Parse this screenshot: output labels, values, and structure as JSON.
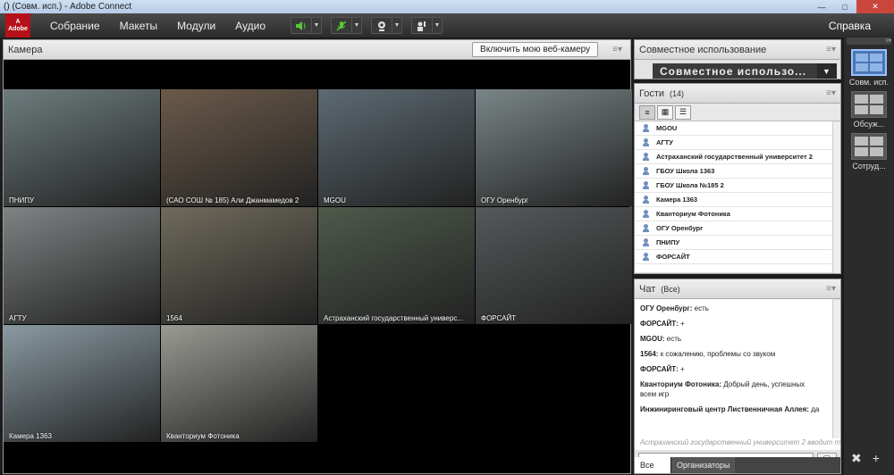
{
  "window": {
    "title": "() (Совм. исп.) - Adobe Connect"
  },
  "menubar": {
    "logo_text": "Adobe",
    "items": [
      "Собрание",
      "Макеты",
      "Модули",
      "Аудио"
    ],
    "help": "Справка"
  },
  "camera_pod": {
    "title": "Камера",
    "webcam_button": "Включить мою веб-камеру",
    "tiles": [
      {
        "label": "ПНИПУ",
        "bg": "#6e7c7d"
      },
      {
        "label": "(САО СОШ № 185) Али Джанмамедов 2",
        "bg": "#6b5a4a"
      },
      {
        "label": "MGOU",
        "bg": "#5d6a72"
      },
      {
        "label": "ОГУ Оренбург",
        "bg": "#7a8587"
      },
      {
        "label": "АГТУ",
        "bg": "#7f8384"
      },
      {
        "label": "1564",
        "bg": "#6f6a5c"
      },
      {
        "label": "Астраханский государственный универс...",
        "bg": "#4e5a4c"
      },
      {
        "label": "ФОРСАЙТ",
        "bg": "#55595a"
      },
      {
        "label": "Камера 1363",
        "bg": "#8a9aa2"
      },
      {
        "label": "Кванториум Фотоника",
        "bg": "#9a9a94"
      }
    ]
  },
  "share_pod": {
    "title": "Совместное использование",
    "selector": "Совместное использо..."
  },
  "guests_pod": {
    "title": "Гости",
    "count": "(14)",
    "guests": [
      "MGOU",
      "АГТУ",
      "Астраханский государственный университет 2",
      "ГБОУ Школа 1363",
      "ГБОУ Школа №185 2",
      "Камера 1363",
      "Кванториум Фотоника",
      "ОГУ Оренбург",
      "ПНИПУ",
      "ФОРСАЙТ"
    ]
  },
  "chat_pod": {
    "title": "Чат",
    "scope": "(Все)",
    "messages": [
      {
        "sender": "ОГУ Оренбург:",
        "text": " есть"
      },
      {
        "sender": "ФОРСАЙТ:",
        "text": " +"
      },
      {
        "sender": "MGOU:",
        "text": " есть"
      },
      {
        "sender": "1564:",
        "text": " к сожалению, проблемы со звуком"
      },
      {
        "sender": "ФОРСАЙТ:",
        "text": " +"
      },
      {
        "sender": "Кванториум Фотоника:",
        "text": " Добрый день, успешных всем игр"
      },
      {
        "sender": "Инжиниринговый центр Лиственничная Аллея:",
        "text": " да"
      }
    ],
    "typing": "Астраханский государственный университет 2 вводит т",
    "tabs": [
      "Все",
      "Организаторы"
    ]
  },
  "layouts": {
    "items": [
      {
        "label": "Совм. исп."
      },
      {
        "label": "Обсуж..."
      },
      {
        "label": "Сотруд..."
      }
    ]
  }
}
